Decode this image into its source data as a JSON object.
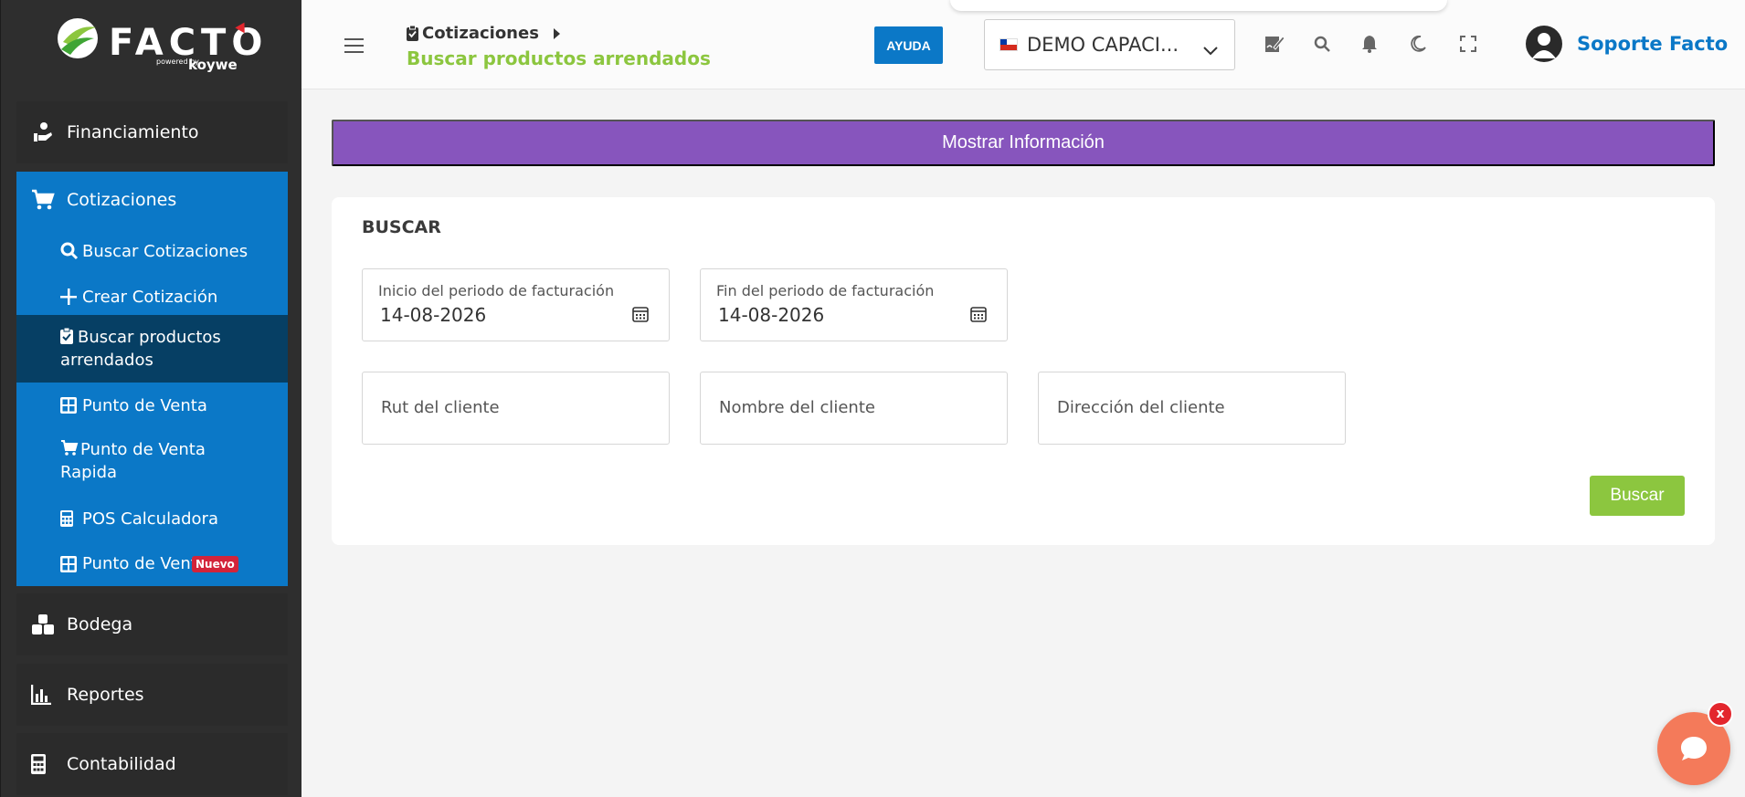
{
  "logo": {
    "text": "FACTO",
    "powered": "powered by",
    "brand": "koywe"
  },
  "sidebar": {
    "financiamiento": "Financiamiento",
    "cotizaciones": {
      "label": "Cotizaciones",
      "items": [
        {
          "label": "Buscar Cotizaciones",
          "icon": "search-icon"
        },
        {
          "label": "Crear Cotización",
          "icon": "plus-icon"
        },
        {
          "label": "Buscar productos arrendados",
          "icon": "clipboard-check-icon",
          "active": true
        },
        {
          "label": "Punto de Venta",
          "icon": "grid-icon"
        },
        {
          "label": "Punto de Venta Rapida",
          "icon": "cart-icon"
        },
        {
          "label": "POS Calculadora",
          "icon": "calculator-icon"
        },
        {
          "label": "Punto de Venta",
          "icon": "grid-icon",
          "badge": "Nuevo"
        }
      ]
    },
    "bodega": "Bodega",
    "reportes": "Reportes",
    "contabilidad": "Contabilidad"
  },
  "header": {
    "breadcrumb": "Cotizaciones",
    "page_title": "Buscar productos arrendados",
    "help_button": "AYUDA",
    "company": "DEMO CAPACI...",
    "user_name": "Soporte Facto"
  },
  "main": {
    "info_button": "Mostrar Información",
    "search": {
      "title": "BUSCAR",
      "start_label": "Inicio del periodo de facturación",
      "start_value": "14-08-2026",
      "end_label": "Fin del periodo de facturación",
      "end_value": "14-08-2026",
      "rut_placeholder": "Rut del cliente",
      "name_placeholder": "Nombre del cliente",
      "address_placeholder": "Dirección del cliente",
      "submit": "Buscar"
    }
  },
  "chat": {
    "close": "x"
  },
  "colors": {
    "primary": "#0b78c7",
    "accent_green": "#8cc63f",
    "purple": "#8755bd",
    "sidebar": "#2e2e2e",
    "chat": "#f47a5a"
  }
}
